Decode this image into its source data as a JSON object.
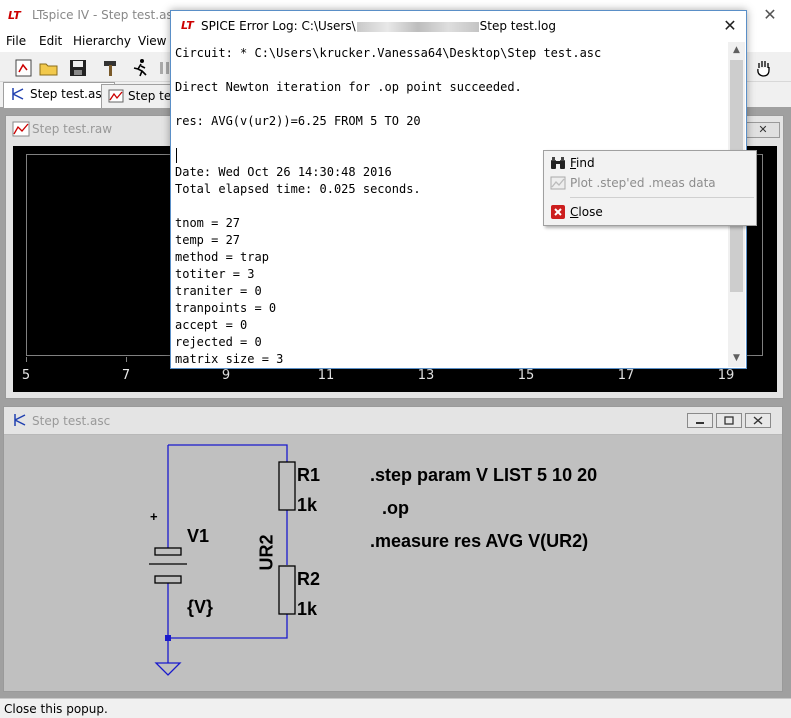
{
  "app": {
    "title": "LTspice IV - Step test.asc",
    "logo_text": "LT",
    "close_glyph": "✕"
  },
  "menu": [
    {
      "label": "File"
    },
    {
      "label": "Edit"
    },
    {
      "label": "Hierarchy"
    },
    {
      "label": "View"
    }
  ],
  "toolbar_icons": [
    "new-schematic-icon",
    "open-folder-icon",
    "save-icon",
    "hammer-icon",
    "run-icon",
    "halt-icon",
    "pan-hand-icon"
  ],
  "tabs": [
    {
      "label": "Step test.asc",
      "active": true
    },
    {
      "label": "Step test",
      "active": false
    }
  ],
  "waveform_window": {
    "title": "Step test.raw",
    "x_ticks": [
      "5",
      "7",
      "9",
      "11",
      "13",
      "15",
      "17",
      "19"
    ],
    "close_glyph": "✕"
  },
  "schematic_window": {
    "title": "Step test.asc",
    "components": {
      "v1_name": "V1",
      "v1_value": "{V}",
      "r1_name": "R1",
      "r1_value": "1k",
      "r2_name": "R2",
      "r2_value": "1k",
      "net_label": "UR2",
      "plus_sign": "+"
    },
    "directives": [
      ".step  param V LIST 5 10 20",
      ".op",
      ".measure res AVG V(UR2)"
    ]
  },
  "error_log": {
    "title_prefix": "SPICE Error Log: C:\\Users\\",
    "title_suffix": "Step test.log",
    "close_glyph": "✕",
    "lines": [
      "Circuit: * C:\\Users\\krucker.Vanessa64\\Desktop\\Step test.asc",
      "",
      "Direct Newton iteration for .op point succeeded.",
      "",
      "res: AVG(v(ur2))=6.25 FROM 5 TO 20",
      "",
      "",
      "Date: Wed Oct 26 14:30:48 2016",
      "Total elapsed time: 0.025 seconds.",
      "",
      "tnom = 27",
      "temp = 27",
      "method = trap",
      "totiter = 3",
      "traniter = 0",
      "tranpoints = 0",
      "accept = 0",
      "rejected = 0",
      "matrix size = 3"
    ]
  },
  "context_menu": {
    "items": [
      {
        "label": "Find",
        "accel": "F",
        "rest": "ind",
        "icon": "binoculars-icon",
        "enabled": true
      },
      {
        "label": "Plot .step'ed .meas data",
        "icon": "plot-icon",
        "enabled": false
      },
      {
        "label": "Close",
        "accel": "C",
        "rest": "lose",
        "icon": "close-red-icon",
        "enabled": true
      }
    ]
  },
  "status": {
    "text": "Close this popup."
  },
  "colors": {
    "wire": "#1a1acc",
    "plot_bg": "#000000",
    "schematic_bg": "#c0c0c0",
    "accent_red": "#cc0000"
  }
}
